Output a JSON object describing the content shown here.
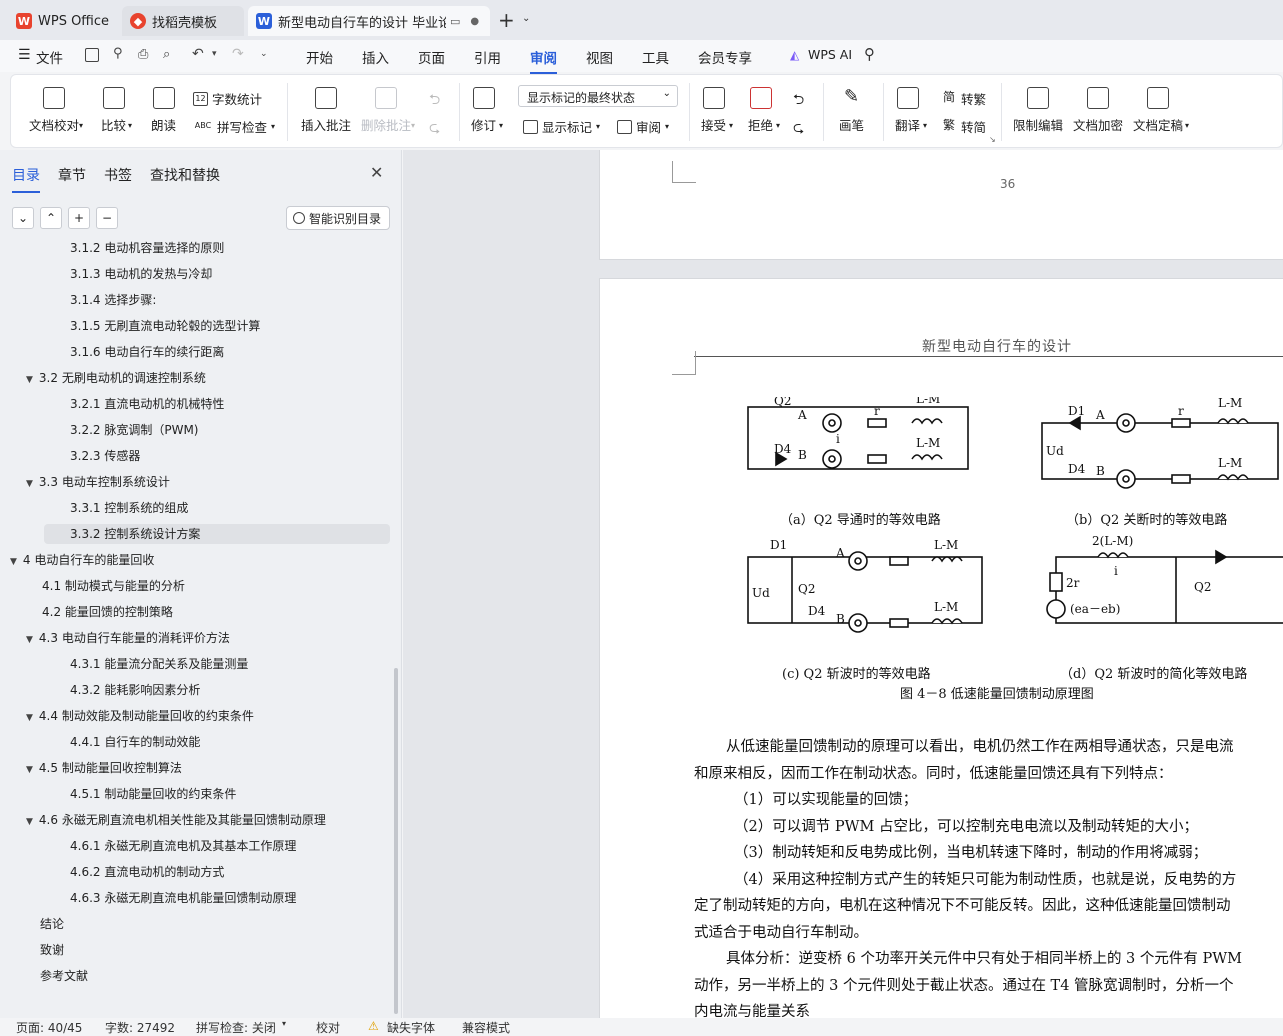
{
  "tabs": [
    {
      "label": "WPS Office",
      "icon": "wps-logo"
    },
    {
      "label": "找稻壳模板",
      "icon": "docer-logo"
    },
    {
      "label": "新型电动自行车的设计 毕业论",
      "icon": "word-logo"
    }
  ],
  "menu": {
    "file": "文件",
    "items": [
      "开始",
      "插入",
      "页面",
      "引用",
      "审阅",
      "视图",
      "工具",
      "会员专享"
    ],
    "ai": "WPS AI"
  },
  "ribbon": {
    "doc_check": "文档校对",
    "compare": "比较",
    "read": "朗读",
    "word_count": "字数统计",
    "spell": "拼写检查",
    "insert_comment": "插入批注",
    "delete_comment": "删除批注",
    "revise": "修订",
    "show_state": "显示标记的最终状态",
    "show_marks": "显示标记",
    "review": "审阅",
    "accept": "接受",
    "reject": "拒绝",
    "pen": "画笔",
    "translate": "翻译",
    "to_trad": "转繁",
    "to_simp": "转简",
    "restrict": "限制编辑",
    "encrypt": "文档加密",
    "finalize": "文档定稿"
  },
  "sidebar": {
    "tabs": [
      "目录",
      "章节",
      "书签",
      "查找和替换"
    ],
    "smart_toc": "智能识别目录",
    "items": [
      {
        "text": "3.1.2  电动机容量选择的原则",
        "level": 3
      },
      {
        "text": "3.1.3  电动机的发热与冷却",
        "level": 3
      },
      {
        "text": "3.1.4  选择步骤:",
        "level": 3
      },
      {
        "text": "3.1.5  无刷直流电动轮毂的选型计算",
        "level": 3
      },
      {
        "text": "3.1.6  电动自行车的续行距离",
        "level": 3
      },
      {
        "text": "3.2  无刷电动机的调速控制系统",
        "level": 2
      },
      {
        "text": "3.2.1  直流电动机的机械特性",
        "level": 3
      },
      {
        "text": "3.2.2  脉宽调制（PWM)",
        "level": 3
      },
      {
        "text": "3.2.3  传感器",
        "level": 3
      },
      {
        "text": "3.3  电动车控制系统设计",
        "level": 2
      },
      {
        "text": "3.3.1  控制系统的组成",
        "level": 3
      },
      {
        "text": "3.3.2  控制系统设计方案",
        "level": 3
      },
      {
        "text": "4  电动自行车的能量回收",
        "level": 1
      },
      {
        "text": "4.1  制动模式与能量的分析",
        "level": 2
      },
      {
        "text": "4.2  能量回馈的控制策略",
        "level": 2
      },
      {
        "text": "4.3  电动自行车能量的消耗评价方法",
        "level": 2
      },
      {
        "text": "4.3.1  能量流分配关系及能量测量",
        "level": 3
      },
      {
        "text": "4.3.2  能耗影响因素分析",
        "level": 3
      },
      {
        "text": "4.4  制动效能及制动能量回收的约束条件",
        "level": 2
      },
      {
        "text": "4.4.1  自行车的制动效能",
        "level": 3
      },
      {
        "text": "4.5  制动能量回收控制算法",
        "level": 2
      },
      {
        "text": "4.5.1  制动能量回收的约束条件",
        "level": 3
      },
      {
        "text": "4.6  永磁无刷直流电机相关性能及其能量回馈制动原理",
        "level": 2
      },
      {
        "text": "4.6.1  永磁无刷直流电机及其基本工作原理",
        "level": 3
      },
      {
        "text": "4.6.2  直流电动机的制动方式",
        "level": 3
      },
      {
        "text": "4.6.3  永磁无刷直流电机能量回馈制动原理",
        "level": 3
      },
      {
        "text": "结论",
        "level": 1
      },
      {
        "text": "致谢",
        "level": 1
      },
      {
        "text": "参考文献",
        "level": 1
      }
    ]
  },
  "doc": {
    "page_number": "36",
    "header": "新型电动自行车的设计",
    "captions": [
      "（a）Q2 导通时的等效电路",
      "（b）Q2 关断时的等效电路",
      "(c) Q2  斩波时的等效电路",
      "（d）Q2 斩波时的简化等效电路"
    ],
    "figure_title": "图 4－8   低速能量回馈制动原理图",
    "lines": [
      "从低速能量回馈制动的原理可以看出，电机仍然工作在两相导通状态，只是电流",
      "和原来相反，因而工作在制动状态。同时，低速能量回馈还具有下列特点：",
      "（1）可以实现能量的回馈；",
      "（2）可以调节 PWM 占空比，可以控制充电电流以及制动转矩的大小；",
      "（3）制动转矩和反电势成比例，当电机转速下降时，制动的作用将减弱；",
      "（4）采用这种控制方式产生的转矩只可能为制动性质，也就是说，反电势的方",
      "定了制动转矩的方向，电机在这种情况下不可能反转。因此，这种低速能量回馈制动",
      "式适合于电动自行车制动。",
      "具体分析：逆变桥 6 个功率开关元件中只有处于相同半桥上的 3 个元件有 PWM",
      "动作，另一半桥上的 3 个元件则处于截止状态。通过在  T4  管脉宽调制时，分析一个",
      "内电流与能量关系"
    ],
    "circuit": {
      "q2": "Q2",
      "d1": "D1",
      "d4": "D4",
      "a": "A",
      "b": "B",
      "ea": "ea",
      "eb": "eb",
      "r": "r",
      "lm": "L-M",
      "i": "i",
      "ud": "Ud",
      "two_lm": "2(L-M)",
      "two_r": "2r",
      "emf": "(ea－eb)"
    }
  },
  "status": {
    "page": "页面: 40/45",
    "words": "字数: 27492",
    "spell": "拼写检查: 关闭",
    "proof": "校对",
    "font": "缺失字体",
    "compat": "兼容模式"
  }
}
